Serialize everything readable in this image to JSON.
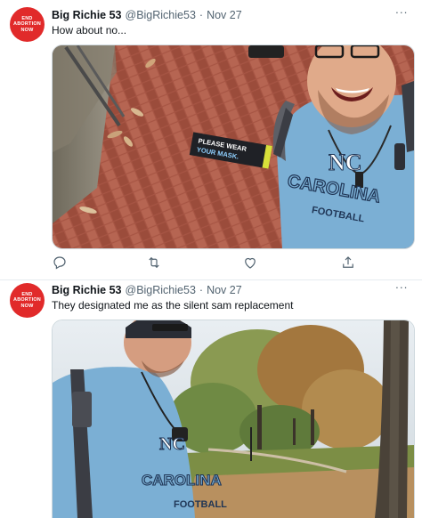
{
  "tweets": [
    {
      "author_name": "Big Richie 53",
      "handle": "@BigRichie53",
      "separator": "·",
      "date": "Nov 27",
      "text": "How about no...",
      "avatar_text": "END\nABORTION\nNOW",
      "media": {
        "sign_line1": "PLEASE WEAR",
        "sign_line2": "YOUR MASK.",
        "shirt_line1": "CAROLINA",
        "shirt_line2": "FOOTBALL"
      },
      "actions": [
        "reply-icon",
        "retweet-icon",
        "like-icon",
        "share-icon"
      ]
    },
    {
      "author_name": "Big Richie 53",
      "handle": "@BigRichie53",
      "separator": "·",
      "date": "Nov 27",
      "text": "They designated me as the silent sam replacement",
      "avatar_text": "END\nABORTION\nNOW",
      "media": {
        "shirt_line1": "CAROLINA",
        "shirt_line2": "FOOTBALL"
      }
    }
  ],
  "colors": {
    "avatar_red": "#e12a2a",
    "secondary_text": "#536471",
    "unc_blue": "#7bafd4",
    "border": "#cfd9de"
  }
}
